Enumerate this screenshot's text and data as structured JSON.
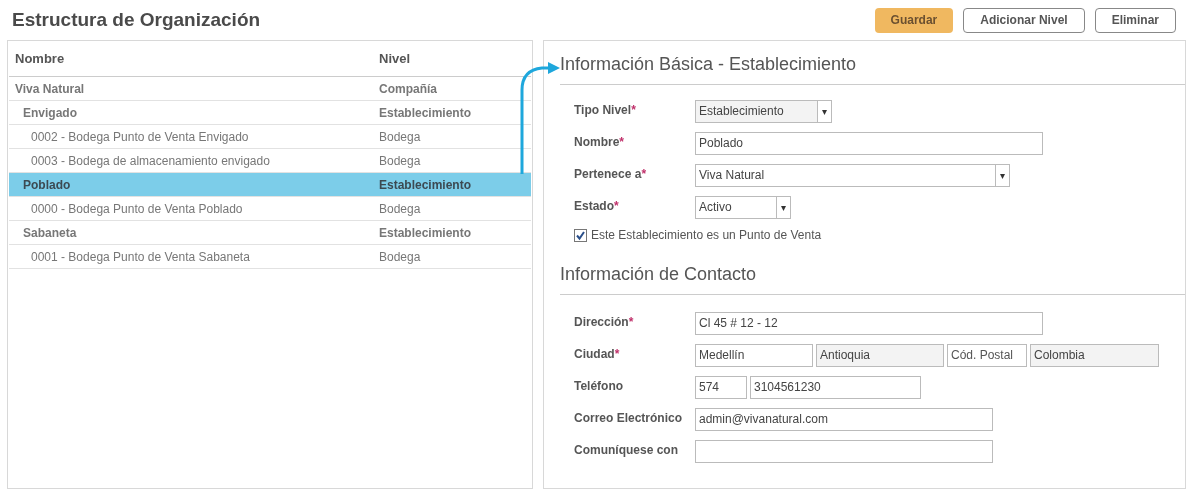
{
  "title": "Estructura de Organización",
  "buttons": [
    {
      "label": "Guardar",
      "kind": "primary"
    },
    {
      "label": "Adicionar Nivel",
      "kind": "default"
    },
    {
      "label": "Eliminar",
      "kind": "default"
    }
  ],
  "tree": {
    "columns": [
      "Nombre",
      "Nivel"
    ],
    "rows": [
      {
        "name": "Viva Natural",
        "level_name": "Compañía",
        "selected": false,
        "children": [
          {
            "name": "Envigado",
            "level_name": "Establecimiento",
            "selected": false,
            "children": [
              {
                "name": "0002 - Bodega Punto de Venta Envigado",
                "level_name": "Bodega",
                "selected": false
              },
              {
                "name": "0003 - Bodega de almacenamiento envigado",
                "level_name": "Bodega",
                "selected": false
              }
            ]
          },
          {
            "name": "Poblado",
            "level_name": "Establecimiento",
            "selected": true,
            "children": [
              {
                "name": "0000 - Bodega Punto de Venta Poblado",
                "level_name": "Bodega",
                "selected": false
              }
            ]
          },
          {
            "name": "Sabaneta",
            "level_name": "Establecimiento",
            "selected": false,
            "children": [
              {
                "name": "0001 - Bodega Punto de Venta Sabaneta",
                "level_name": "Bodega",
                "selected": false
              }
            ]
          }
        ]
      }
    ]
  },
  "sections": [
    {
      "title": "Información Básica - Establecimiento",
      "fields": [
        {
          "kind": "select",
          "label": "Tipo Nivel",
          "required_mark": "*",
          "value": "Establecimiento",
          "disabled": true,
          "arrow": "▾"
        },
        {
          "kind": "text",
          "label": "Nombre",
          "required_mark": "*",
          "inputs": [
            {
              "value": "Poblado",
              "disabled": false
            }
          ]
        },
        {
          "kind": "select",
          "label": "Pertenece a",
          "required_mark": "*",
          "value": "Viva Natural",
          "disabled": false,
          "arrow": "▾"
        },
        {
          "kind": "select",
          "label": "Estado",
          "required_mark": "*",
          "value": "Activo",
          "disabled": false,
          "arrow": "▾"
        },
        {
          "kind": "checkbox",
          "label": "Este Establecimiento es un Punto de Venta",
          "checked": true
        }
      ]
    },
    {
      "title": "Información de Contacto",
      "fields": [
        {
          "kind": "text",
          "label": "Dirección",
          "required_mark": "*",
          "inputs": [
            {
              "value": "Cl 45 # 12 - 12",
              "disabled": false
            }
          ]
        },
        {
          "kind": "text",
          "label": "Ciudad",
          "required_mark": "*",
          "inputs": [
            {
              "value": "Medellín",
              "disabled": false
            },
            {
              "value": "Antioquia",
              "disabled": true
            },
            {
              "placeholder": "Cód. Postal",
              "disabled": false
            },
            {
              "value": "Colombia",
              "disabled": true
            }
          ]
        },
        {
          "kind": "text",
          "label": "Teléfono",
          "inputs": [
            {
              "value": "574",
              "disabled": false
            },
            {
              "value": "3104561230",
              "disabled": false
            }
          ]
        },
        {
          "kind": "text",
          "label": "Correo Electrónico",
          "inputs": [
            {
              "value": "admin@vivanatural.com",
              "disabled": false
            }
          ]
        },
        {
          "kind": "text",
          "label": "Comuníquese con",
          "inputs": [
            {
              "disabled": false
            }
          ]
        }
      ]
    }
  ]
}
